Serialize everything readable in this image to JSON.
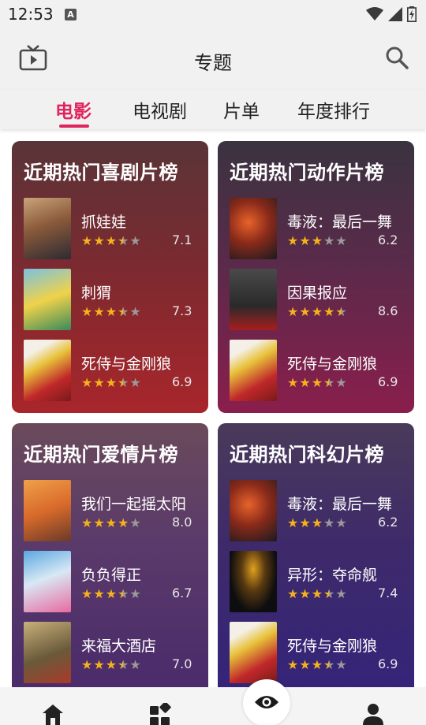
{
  "status": {
    "time": "12:53",
    "notif_letter": "A"
  },
  "header": {
    "title": "专题"
  },
  "tabs": [
    {
      "label": "电影",
      "active": true
    },
    {
      "label": "电视剧",
      "active": false
    },
    {
      "label": "片单",
      "active": false
    },
    {
      "label": "年度排行",
      "active": false
    }
  ],
  "lists": [
    {
      "title": "近期热门喜剧片榜",
      "movies": [
        {
          "title": "抓娃娃",
          "rating": "7.1",
          "stars": 3.5
        },
        {
          "title": "刺猬",
          "rating": "7.3",
          "stars": 3.5
        },
        {
          "title": "死侍与金刚狼",
          "rating": "6.9",
          "stars": 3.5
        }
      ]
    },
    {
      "title": "近期热门动作片榜",
      "movies": [
        {
          "title": "毒液：最后一舞",
          "rating": "6.2",
          "stars": 3
        },
        {
          "title": "因果报应",
          "rating": "8.6",
          "stars": 4.5
        },
        {
          "title": "死侍与金刚狼",
          "rating": "6.9",
          "stars": 3.5
        }
      ]
    },
    {
      "title": "近期热门爱情片榜",
      "movies": [
        {
          "title": "我们一起摇太阳",
          "rating": "8.0",
          "stars": 4
        },
        {
          "title": "负负得正",
          "rating": "6.7",
          "stars": 3.5
        },
        {
          "title": "来福大酒店",
          "rating": "7.0",
          "stars": 3.5
        }
      ]
    },
    {
      "title": "近期热门科幻片榜",
      "movies": [
        {
          "title": "毒液：最后一舞",
          "rating": "6.2",
          "stars": 3
        },
        {
          "title": "异形：夺命舰",
          "rating": "7.4",
          "stars": 3.5
        },
        {
          "title": "死侍与金刚狼",
          "rating": "6.9",
          "stars": 3.5
        }
      ]
    }
  ],
  "bottom_nav": [
    {
      "icon": "home-icon"
    },
    {
      "icon": "grid-icon"
    },
    {
      "icon": "eye-icon"
    },
    {
      "icon": "profile-icon"
    }
  ],
  "colors": {
    "accent": "#e0245e",
    "star_filled": "#f5b21c",
    "star_empty": "#9a9a9a"
  }
}
